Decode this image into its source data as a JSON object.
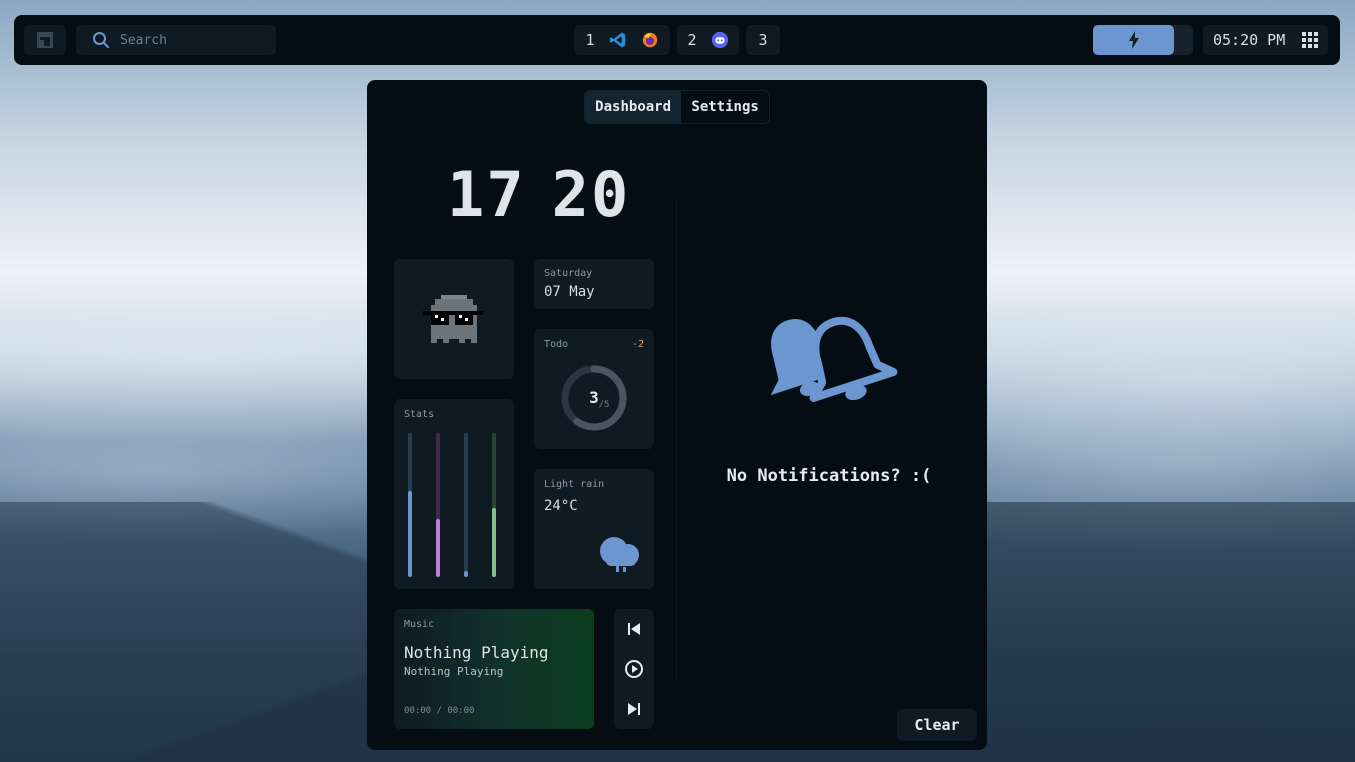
{
  "topbar": {
    "search_placeholder": "Search",
    "workspaces": [
      {
        "number": "1",
        "apps": [
          "vscode-icon",
          "firefox-icon"
        ]
      },
      {
        "number": "2",
        "apps": [
          "discord-icon"
        ]
      },
      {
        "number": "3",
        "apps": []
      }
    ],
    "battery_level": 0.81,
    "time": "05:20 PM"
  },
  "dashboard": {
    "tabs": [
      "Dashboard",
      "Settings"
    ],
    "active_tab": "Dashboard",
    "clock": {
      "hour": "17",
      "minute": "20"
    },
    "date": {
      "day": "Saturday",
      "date": "07 May"
    },
    "todo": {
      "label": "Todo",
      "delta": "-2",
      "done": "3",
      "total": "/5",
      "progress": 0.6
    },
    "stats": {
      "label": "Stats",
      "bars": [
        {
          "name": "cpu",
          "level": 0.6,
          "color": "#6b96cf",
          "track": "#2b3c4c"
        },
        {
          "name": "memory",
          "level": 0.4,
          "color": "#c07ae0",
          "track": "#3a2f4a"
        },
        {
          "name": "disk",
          "level": 0.04,
          "color": "#6b96cf",
          "track": "#2b3c4c"
        },
        {
          "name": "temperature",
          "level": 0.48,
          "color": "#7bc48c",
          "track": "#2c4237"
        }
      ]
    },
    "weather": {
      "condition": "Light rain",
      "temperature": "24°C",
      "icon": "rain-cloud-icon"
    },
    "music": {
      "label": "Music",
      "title": "Nothing Playing",
      "artist": "Nothing Playing",
      "time": "00:00 / 00:00"
    },
    "notifications": {
      "empty_text": "No Notifications? :(",
      "clear_label": "Clear"
    }
  },
  "colors": {
    "accent": "#6b96cf",
    "panel": "#050d14",
    "card": "#0f1a22",
    "text": "#dfe4e8"
  }
}
